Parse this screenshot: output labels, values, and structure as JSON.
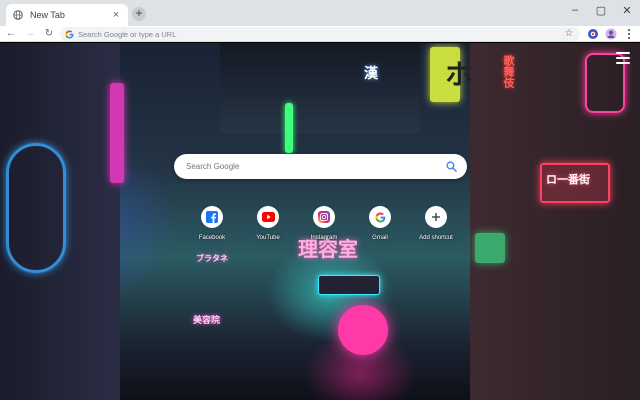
{
  "browser": {
    "tab": {
      "title": "New Tab",
      "close_glyph": "×",
      "favicon": "globe-icon"
    },
    "new_tab_glyph": "+",
    "window_controls": {
      "minimize": "–",
      "maximize": "▢",
      "close": "✕"
    },
    "toolbar": {
      "back_glyph": "←",
      "forward_glyph": "→",
      "reload_glyph": "↻",
      "omnibox_placeholder": "Search Google or type a URL",
      "star_glyph": "☆"
    }
  },
  "page": {
    "search_placeholder": "Search Google",
    "shortcuts": [
      {
        "label": "Facebook",
        "icon": "facebook-icon",
        "color": "#1877f2"
      },
      {
        "label": "YouTube",
        "icon": "youtube-icon",
        "color": "#ff0000"
      },
      {
        "label": "Instagram",
        "icon": "instagram-icon",
        "color": "#c13584"
      },
      {
        "label": "Gmail",
        "icon": "google-icon",
        "color": "#4285f4"
      },
      {
        "label": "Add shortcut",
        "icon": "plus-icon",
        "color": "#3c4043"
      }
    ],
    "background_signs": {
      "sign1": "理容室",
      "sign2": "ブラタネ",
      "sign3": "ホ",
      "sign4": "歌舞伎",
      "sign5": "漢",
      "sign6": "美容院",
      "sign7": "ロ一番街"
    }
  },
  "colors": {
    "tabstrip": "#dee1e6",
    "toolbar": "#ffffff",
    "omnibox": "#f1f3f4"
  }
}
